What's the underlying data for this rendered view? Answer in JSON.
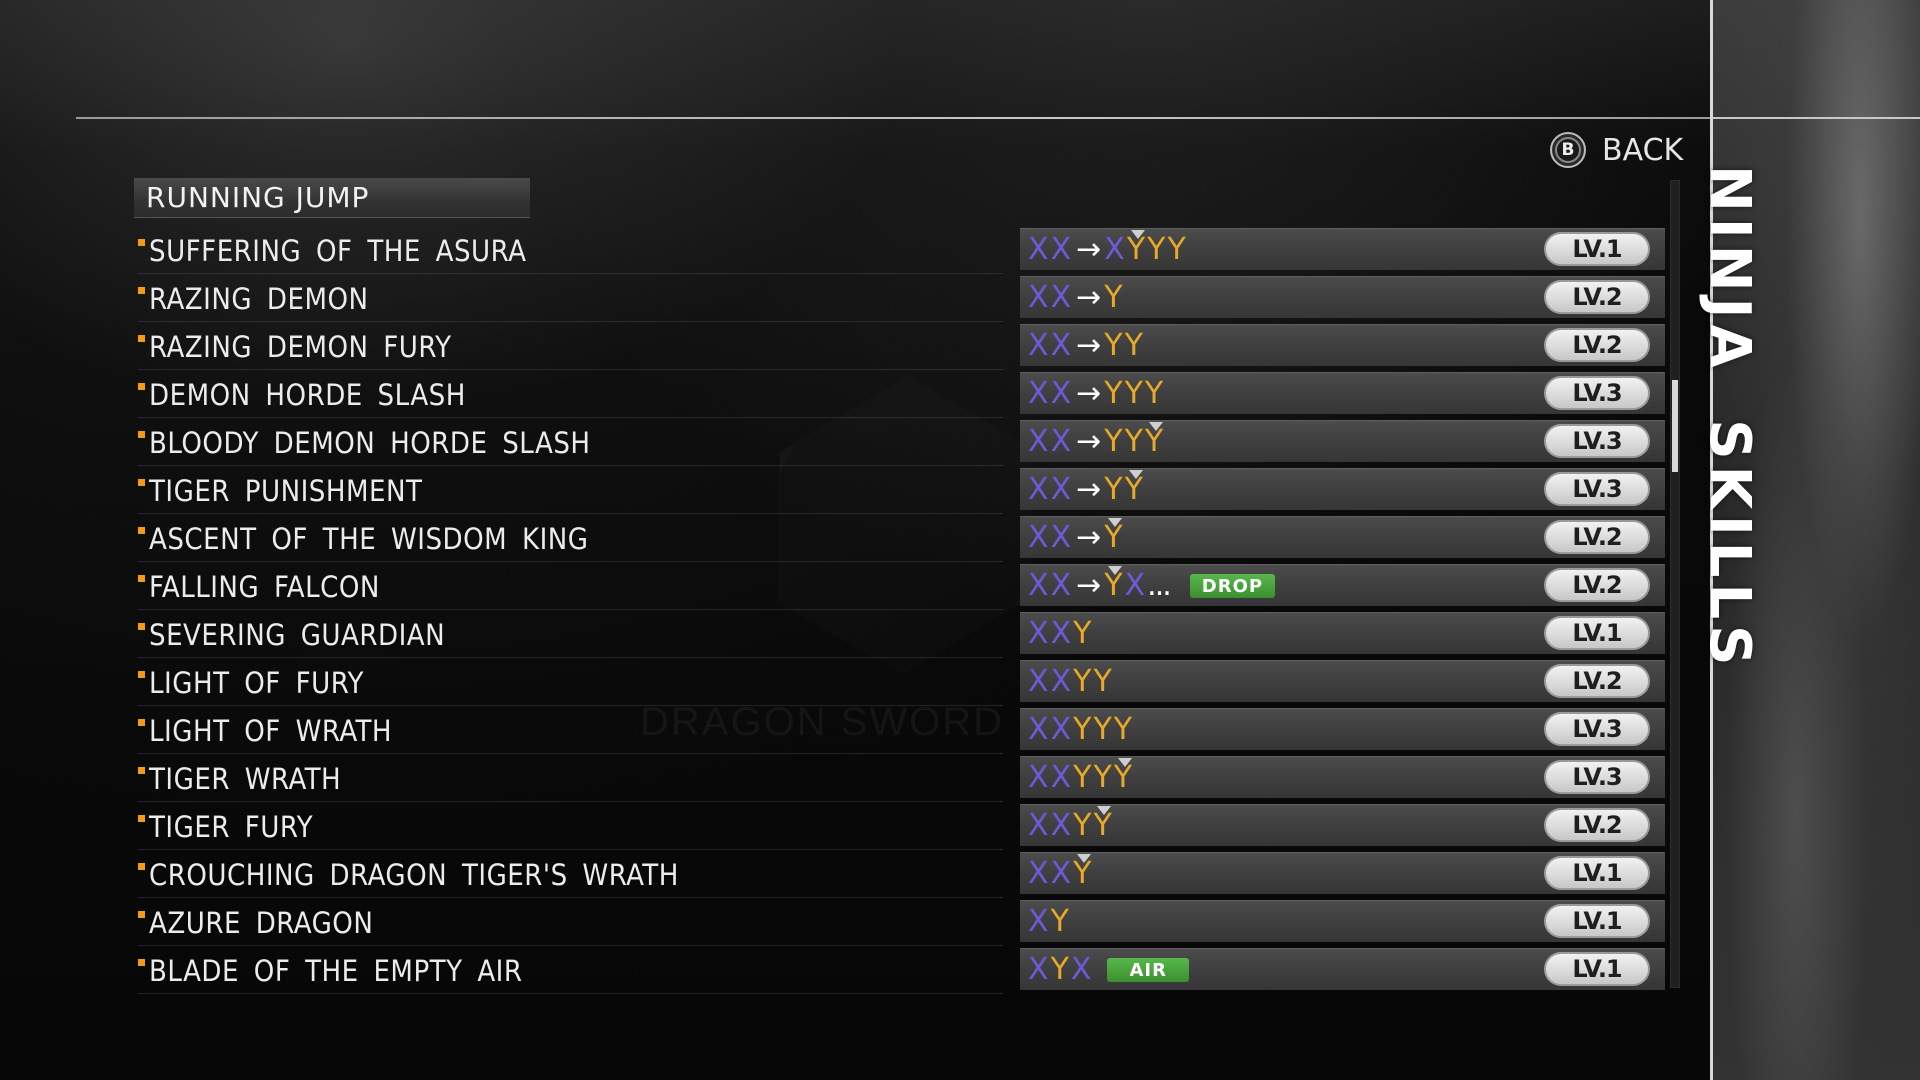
{
  "header": {
    "category": "RUNNING JUMP",
    "back_label": "BACK",
    "back_button_glyph": "B",
    "side_title": "NINJA SKILLS"
  },
  "background": {
    "watermark": "DRAGON SWORD"
  },
  "combo_legend": {
    "X": "X button (purple)",
    "Y": "Y button (orange)",
    "YH": "Y button hold (orange with hold marker)"
  },
  "colors": {
    "x_button": "#6e5ad8",
    "y_button": "#e7a928",
    "bullet": "#f39c12",
    "tag_green": "#4ea83f"
  },
  "skills": [
    {
      "name": "SUFFERING  OF  THE  ASURA",
      "combo": [
        "X",
        "X",
        "→",
        "X",
        "YH",
        "Y",
        "Y"
      ],
      "tag": "",
      "level": "LV.1"
    },
    {
      "name": "RAZING  DEMON",
      "combo": [
        "X",
        "X",
        "→",
        "Y"
      ],
      "tag": "",
      "level": "LV.2"
    },
    {
      "name": "RAZING  DEMON  FURY",
      "combo": [
        "X",
        "X",
        "→",
        "Y",
        "Y"
      ],
      "tag": "",
      "level": "LV.2"
    },
    {
      "name": "DEMON  HORDE  SLASH",
      "combo": [
        "X",
        "X",
        "→",
        "Y",
        "Y",
        "Y"
      ],
      "tag": "",
      "level": "LV.3"
    },
    {
      "name": "BLOODY  DEMON  HORDE  SLASH",
      "combo": [
        "X",
        "X",
        "→",
        "Y",
        "Y",
        "YH"
      ],
      "tag": "",
      "level": "LV.3"
    },
    {
      "name": "TIGER  PUNISHMENT",
      "combo": [
        "X",
        "X",
        "→",
        "Y",
        "YH"
      ],
      "tag": "",
      "level": "LV.3"
    },
    {
      "name": "ASCENT  OF  THE  WISDOM  KING",
      "combo": [
        "X",
        "X",
        "→",
        "YH"
      ],
      "tag": "",
      "level": "LV.2"
    },
    {
      "name": "FALLING  FALCON",
      "combo": [
        "X",
        "X",
        "→",
        "YH",
        "X",
        "..."
      ],
      "tag": "DROP",
      "level": "LV.2"
    },
    {
      "name": "SEVERING  GUARDIAN",
      "combo": [
        "X",
        "X",
        "Y"
      ],
      "tag": "",
      "level": "LV.1"
    },
    {
      "name": "LIGHT  OF  FURY",
      "combo": [
        "X",
        "X",
        "Y",
        "Y"
      ],
      "tag": "",
      "level": "LV.2"
    },
    {
      "name": "LIGHT  OF  WRATH",
      "combo": [
        "X",
        "X",
        "Y",
        "Y",
        "Y"
      ],
      "tag": "",
      "level": "LV.3"
    },
    {
      "name": "TIGER  WRATH",
      "combo": [
        "X",
        "X",
        "Y",
        "Y",
        "YH"
      ],
      "tag": "",
      "level": "LV.3"
    },
    {
      "name": "TIGER  FURY",
      "combo": [
        "X",
        "X",
        "Y",
        "YH"
      ],
      "tag": "",
      "level": "LV.2"
    },
    {
      "name": "CROUCHING  DRAGON  TIGER'S  WRATH",
      "combo": [
        "X",
        "X",
        "YH"
      ],
      "tag": "",
      "level": "LV.1"
    },
    {
      "name": "AZURE  DRAGON",
      "combo": [
        "X",
        "Y"
      ],
      "tag": "",
      "level": "LV.1"
    },
    {
      "name": "BLADE  OF  THE  EMPTY  AIR",
      "combo": [
        "X",
        "Y",
        "X"
      ],
      "tag": "AIR",
      "level": "LV.1"
    }
  ],
  "scrollbar": {
    "position_fraction": 0.28
  }
}
